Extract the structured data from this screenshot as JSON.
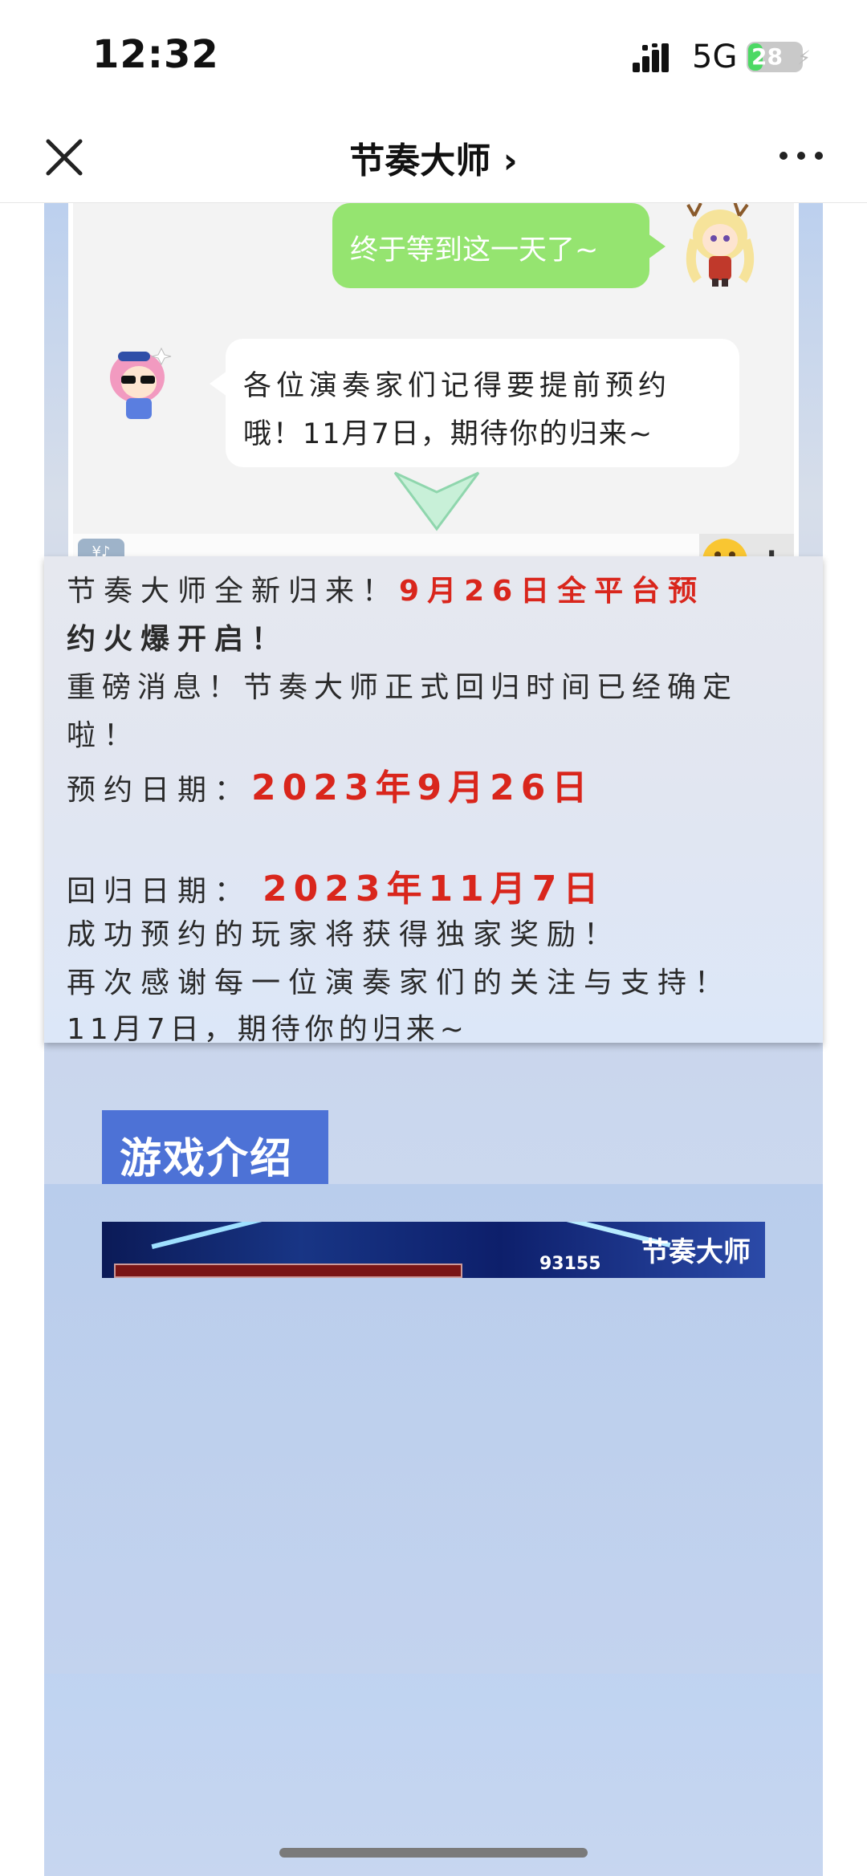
{
  "status": {
    "time": "12:32",
    "network": "5G",
    "battery": "28",
    "battery_level": 0.28
  },
  "nav": {
    "title": "节奏大师 ›",
    "close_icon": "close-icon",
    "more_icon": "more-icon"
  },
  "chat": {
    "green_message": "终于等到这一天了~",
    "white_line1": "各位演奏家们记得要提前预约",
    "white_line2": "哦！11月7日，期待你的归来~",
    "keyboard_icon_label": "¥♪ &%"
  },
  "announcement": {
    "line1_normal": "节奏大师全新归来！",
    "line1_red": "9月26日全平台预",
    "line2_red": "约火爆开启！",
    "line3": "重磅消息！节奏大师正式回归时间已经确定",
    "line4": "啦！",
    "reserve_label": "预约日期：",
    "reserve_date": "2023年9月26日",
    "return_label": "回归日期：",
    "return_date": "2023年11月7日",
    "line_reward": "成功预约的玩家将获得独家奖励！",
    "line_thanks": "再次感谢每一位演奏家们的关注与支持！",
    "line_end": "11月7日，期待你的归来~"
  },
  "section": {
    "title": "游戏介绍"
  },
  "game_shot": {
    "score": "93155",
    "logo": "节奏大师"
  },
  "colors": {
    "accent_red": "#d9261c",
    "section_blue": "#4d72d6",
    "bubble_green": "#95e470"
  }
}
